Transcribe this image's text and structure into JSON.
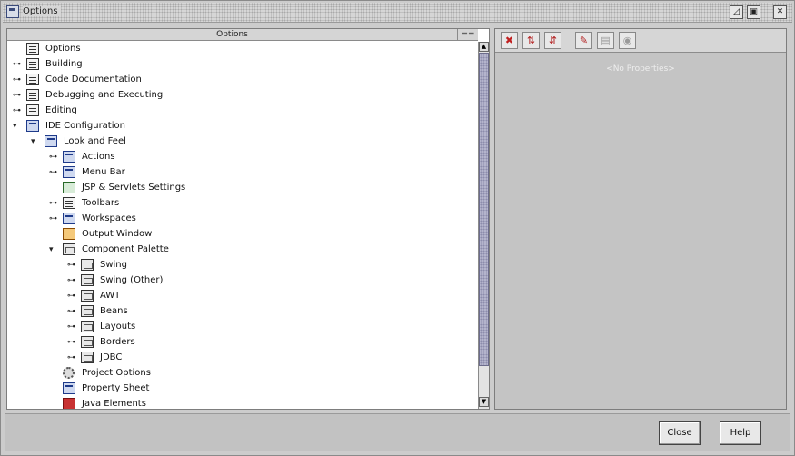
{
  "window": {
    "title": "Options",
    "buttons": [
      "maximize-icon",
      "restore-icon",
      "close-icon"
    ]
  },
  "tree": {
    "column_options": "Options",
    "column_ext": "==",
    "items": [
      {
        "label": "Options",
        "depth": 0,
        "toggle": "",
        "icon": "folder-icon"
      },
      {
        "label": "Building",
        "depth": 0,
        "toggle": "⊶",
        "icon": "folder-icon"
      },
      {
        "label": "Code Documentation",
        "depth": 0,
        "toggle": "⊶",
        "icon": "folder-icon"
      },
      {
        "label": "Debugging and Executing",
        "depth": 0,
        "toggle": "⊶",
        "icon": "folder-icon"
      },
      {
        "label": "Editing",
        "depth": 0,
        "toggle": "⊶",
        "icon": "folder-icon"
      },
      {
        "label": "IDE Configuration",
        "depth": 0,
        "toggle": "▾",
        "icon": "blue-folder-icon"
      },
      {
        "label": "Look and Feel",
        "depth": 1,
        "toggle": "▾",
        "icon": "blue-folder-icon"
      },
      {
        "label": "Actions",
        "depth": 2,
        "toggle": "⊶",
        "icon": "actions-icon"
      },
      {
        "label": "Menu Bar",
        "depth": 2,
        "toggle": "⊶",
        "icon": "menubar-icon"
      },
      {
        "label": "JSP & Servlets Settings",
        "depth": 2,
        "toggle": "",
        "icon": "jsp-icon"
      },
      {
        "label": "Toolbars",
        "depth": 2,
        "toggle": "⊶",
        "icon": "toolbars-icon"
      },
      {
        "label": "Workspaces",
        "depth": 2,
        "toggle": "⊶",
        "icon": "workspaces-icon"
      },
      {
        "label": "Output Window",
        "depth": 2,
        "toggle": "",
        "icon": "output-window-icon"
      },
      {
        "label": "Component Palette",
        "depth": 2,
        "toggle": "▾",
        "icon": "palette-icon"
      },
      {
        "label": "Swing",
        "depth": 3,
        "toggle": "⊶",
        "icon": "palette-icon"
      },
      {
        "label": "Swing (Other)",
        "depth": 3,
        "toggle": "⊶",
        "icon": "palette-icon"
      },
      {
        "label": "AWT",
        "depth": 3,
        "toggle": "⊶",
        "icon": "palette-icon"
      },
      {
        "label": "Beans",
        "depth": 3,
        "toggle": "⊶",
        "icon": "palette-icon"
      },
      {
        "label": "Layouts",
        "depth": 3,
        "toggle": "⊶",
        "icon": "palette-icon"
      },
      {
        "label": "Borders",
        "depth": 3,
        "toggle": "⊶",
        "icon": "palette-icon"
      },
      {
        "label": "JDBC",
        "depth": 3,
        "toggle": "⊶",
        "icon": "palette-icon"
      },
      {
        "label": "Project Options",
        "depth": 2,
        "toggle": "",
        "icon": "project-options-icon"
      },
      {
        "label": "Property Sheet",
        "depth": 2,
        "toggle": "",
        "icon": "property-sheet-icon"
      },
      {
        "label": "Java Elements",
        "depth": 2,
        "toggle": "",
        "icon": "java-elements-icon"
      }
    ]
  },
  "properties": {
    "toolbar": [
      {
        "name": "unsorted-icon",
        "glyph": "✖",
        "color": "#c02020"
      },
      {
        "name": "sort-by-name-icon",
        "glyph": "⇅",
        "color": "#b01818"
      },
      {
        "name": "sort-by-type-icon",
        "glyph": "⇵",
        "color": "#b01818"
      },
      {
        "name": "show-editable-icon",
        "glyph": "✎",
        "color": "#b01818"
      },
      {
        "name": "property-sheet-icon",
        "glyph": "▤",
        "color": "#9a9a9a"
      },
      {
        "name": "customize-icon",
        "glyph": "◉",
        "color": "#9a9a9a"
      }
    ],
    "empty_text": "<No Properties>"
  },
  "buttons": {
    "close": "Close",
    "help": "Help"
  }
}
